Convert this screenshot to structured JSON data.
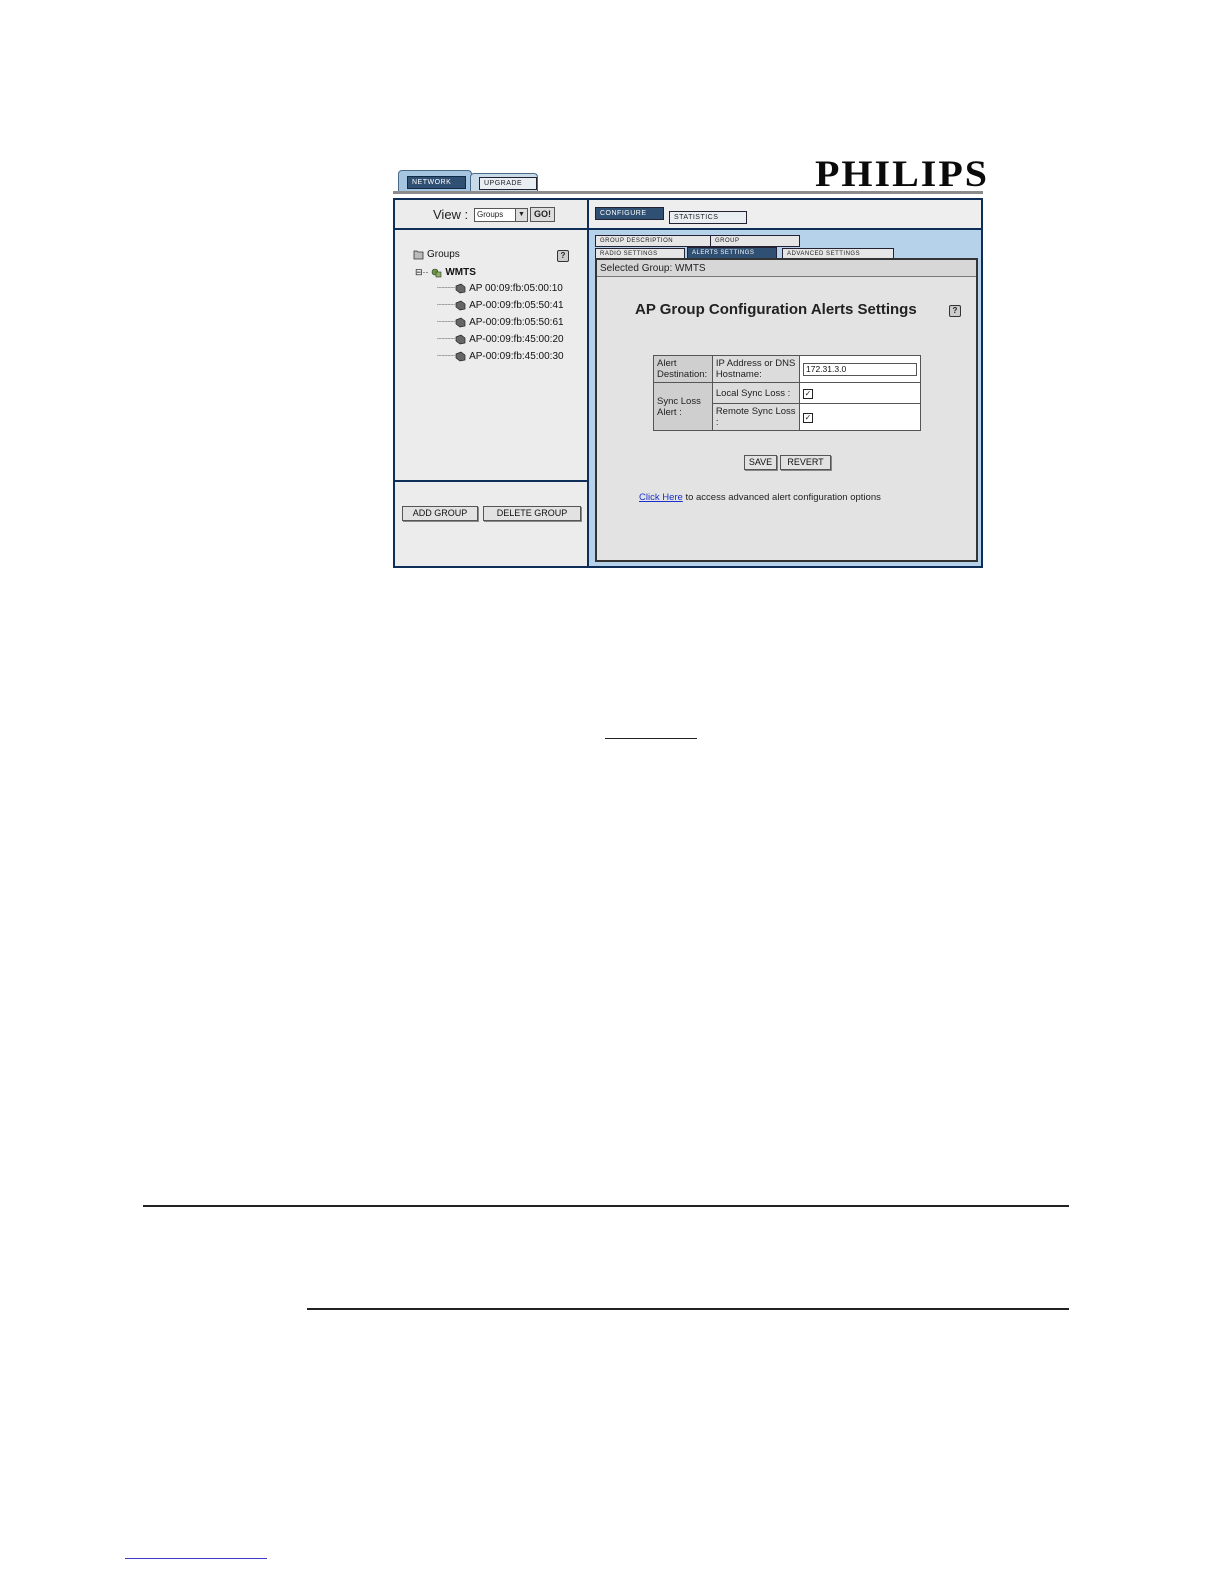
{
  "top_tabs": [
    {
      "label": "NETWORK",
      "active": true
    },
    {
      "label": "UPGRADE",
      "active": false
    }
  ],
  "brand": {
    "logo_text": "PHILIPS"
  },
  "left_pane": {
    "view_label": "View :",
    "view_select_value": "Groups",
    "go_label": "GO!",
    "tree": {
      "root_label": "Groups",
      "group_label": "WMTS",
      "aps": [
        "AP 00:09:fb:05:00:10",
        "AP-00:09:fb:05:50:41",
        "AP-00:09:fb:05:50:61",
        "AP-00:09:fb:45:00:20",
        "AP-00:09:fb:45:00:30"
      ]
    },
    "add_group_label": "ADD GROUP",
    "delete_group_label": "DELETE GROUP"
  },
  "right_pane": {
    "main_tabs": [
      {
        "label": "CONFIGURE",
        "active": true
      },
      {
        "label": "STATISTICS",
        "active": false
      }
    ],
    "sub_tabs_row1": [
      "GROUP DESCRIPTION",
      "GROUP MEMBERSHIP"
    ],
    "sub_tabs_row2": [
      "RADIO SETTINGS",
      "ALERTS SETTINGS",
      "ADVANCED SETTINGS"
    ],
    "active_sub_tab": "ALERTS SETTINGS",
    "selected_group_text": "Selected Group: WMTS",
    "title": "AP Group Configuration Alerts Settings",
    "table": {
      "alert_destination_label": "Alert Destination:",
      "ip_label": "IP Address or DNS Hostname:",
      "ip_value": "172.31.3.0",
      "sync_loss_label": "Sync Loss Alert :",
      "local_sync_label": "Local Sync Loss :",
      "local_sync_checked": true,
      "remote_sync_label": "Remote Sync Loss :",
      "remote_sync_checked": true
    },
    "save_label": "SAVE",
    "revert_label": "REVERT",
    "click_here_label": "Click Here",
    "click_here_note": " to access advanced alert configuration options"
  },
  "help_icon_text": "?",
  "colors": {
    "frame_border": "#0f2e57",
    "right_pane_bg": "#b6d1ea",
    "active_tab": "#2f4f73",
    "link": "#1a2fcc"
  }
}
